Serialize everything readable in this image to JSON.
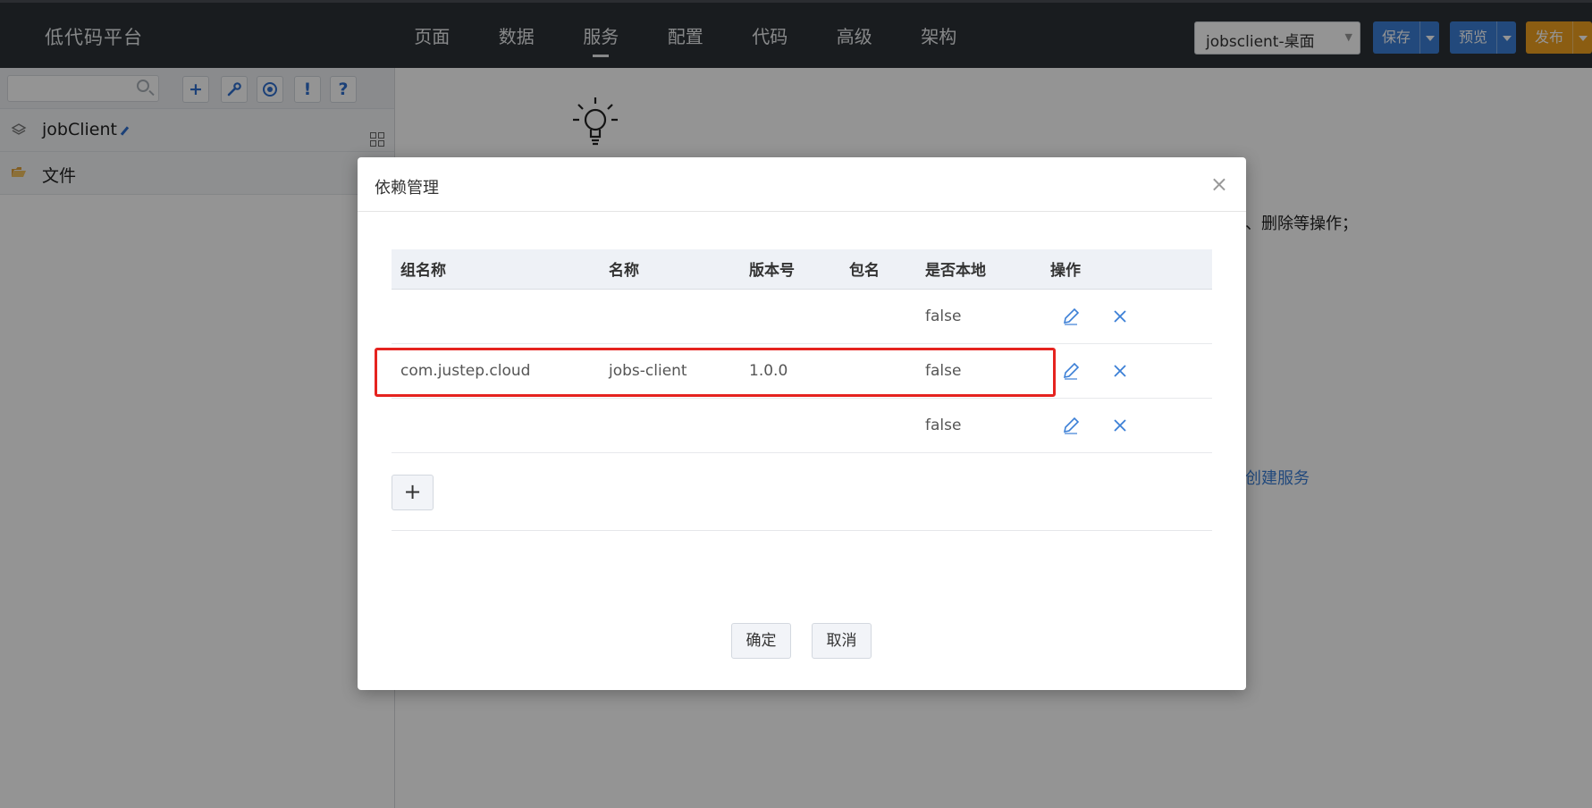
{
  "app": {
    "title": "低代码平台"
  },
  "nav": {
    "items": [
      "页面",
      "数据",
      "服务",
      "配置",
      "代码",
      "高级",
      "架构"
    ],
    "active_index": 2
  },
  "header": {
    "project_select": "jobsclient-桌面",
    "save_label": "保存",
    "preview_label": "预览",
    "publish_label": "发布"
  },
  "sidebar": {
    "search_placeholder": "",
    "tool_buttons": [
      "+",
      "wrench",
      "target",
      "!",
      "?"
    ],
    "tree": [
      {
        "label": "jobClient",
        "icon": "layers-icon",
        "editable": true
      },
      {
        "label": "文件",
        "icon": "folder-open-icon"
      }
    ]
  },
  "background": {
    "text_fragment": "、删除等操作；",
    "link_fragment": "创建服务"
  },
  "modal": {
    "title": "依赖管理",
    "close": "×",
    "columns": [
      "组名称",
      "名称",
      "版本号",
      "包名",
      "是否本地",
      "操作"
    ],
    "rows": [
      {
        "group": "",
        "name": "",
        "version": "",
        "package": "",
        "local": "false"
      },
      {
        "group": "com.justep.cloud",
        "name": "jobs-client",
        "version": "1.0.0",
        "package": "",
        "local": "false",
        "highlighted": true
      },
      {
        "group": "",
        "name": "",
        "version": "",
        "package": "",
        "local": "false"
      }
    ],
    "add_label": "+",
    "ok_label": "确定",
    "cancel_label": "取消"
  },
  "colors": {
    "topbar": "#2b3136",
    "primary": "#3b7fd6",
    "publish": "#f0a020",
    "highlight": "#e5231f"
  }
}
